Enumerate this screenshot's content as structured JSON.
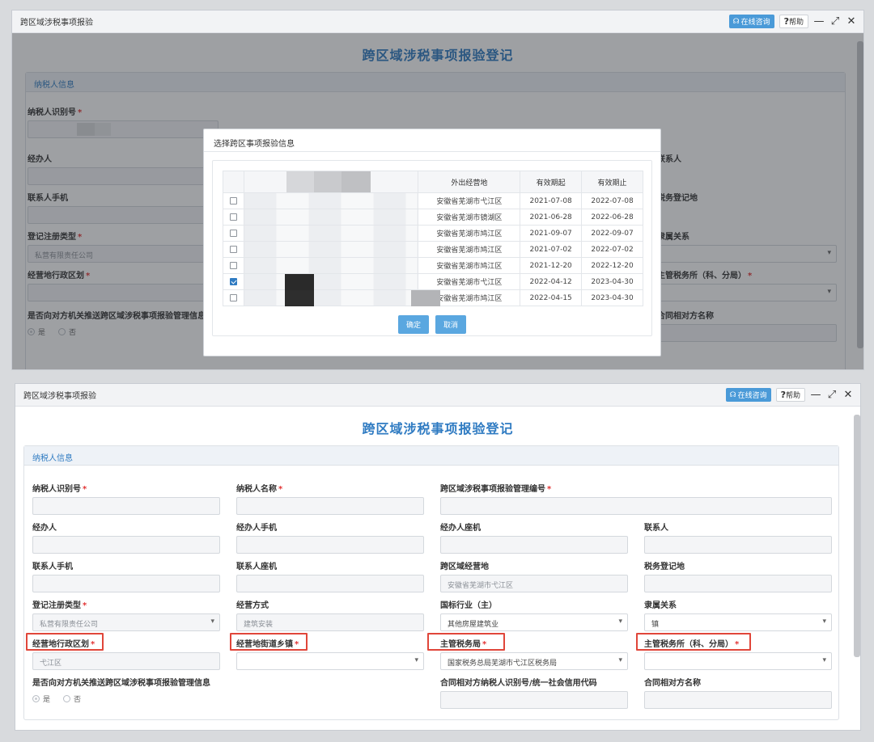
{
  "window": {
    "title": "跨区域涉税事项报验",
    "consult_label": "在线咨询",
    "help_label": "帮助",
    "help_mark": "?",
    "minimize": "—",
    "maximize": "⤢",
    "close": "✕"
  },
  "page_title": "跨区域涉税事项报验登记",
  "section_title": "纳税人信息",
  "fields": {
    "taxpayer_id": "纳税人识别号",
    "taxpayer_name": "纳税人名称",
    "mgmt_no": "跨区域涉税事项报验管理编号",
    "agent": "经办人",
    "agent_phone": "经办人手机",
    "agent_landline": "经办人座机",
    "contact": "联系人",
    "contact_phone": "联系人手机",
    "contact_landline": "联系人座机",
    "cross_region_place": "跨区域经营地",
    "cross_region_place_value": "安徽省芜湖市弋江区",
    "tax_reg_place": "税务登记地",
    "reg_type": "登记注册类型",
    "reg_type_value": "私营有限责任公司",
    "biz_mode": "经营方式",
    "biz_mode_value": "建筑安装",
    "industry": "国标行业（主）",
    "industry_value": "其他房屋建筑业",
    "affiliation": "隶属关系",
    "affiliation_value": "镇",
    "admin_district": "经营地行政区划",
    "admin_district_value": "弋江区",
    "street_town": "经营地街道乡镇",
    "tax_bureau": "主管税务局",
    "tax_bureau_value": "国家税务总局芜湖市弋江区税务局",
    "tax_office": "主管税务所（科、分局）",
    "push_info": "是否向对方机关推送跨区域涉税事项报验管理信息",
    "yes": "是",
    "no": "否",
    "counterparty_id": "合同相对方纳税人识别号/统一社会信用代码",
    "counterparty_name": "合同相对方名称"
  },
  "modal": {
    "title": "选择跨区事项报验信息",
    "headers": [
      "外出经营地",
      "有效期起",
      "有效期止"
    ],
    "rows": [
      {
        "place": "安徽省芜湖市弋江区",
        "start": "2021-07-08",
        "end": "2022-07-08",
        "checked": false
      },
      {
        "place": "安徽省芜湖市镜湖区",
        "start": "2021-06-28",
        "end": "2022-06-28",
        "checked": false
      },
      {
        "place": "安徽省芜湖市鸠江区",
        "start": "2021-09-07",
        "end": "2022-09-07",
        "checked": false
      },
      {
        "place": "安徽省芜湖市鸠江区",
        "start": "2021-07-02",
        "end": "2022-07-02",
        "checked": false
      },
      {
        "place": "安徽省芜湖市鸠江区",
        "start": "2021-12-20",
        "end": "2022-12-20",
        "checked": false
      },
      {
        "place": "安徽省芜湖市弋江区",
        "start": "2022-04-12",
        "end": "2023-04-30",
        "checked": true
      },
      {
        "place": "安徽省芜湖市鸠江区",
        "start": "2022-04-15",
        "end": "2023-04-30",
        "checked": false
      }
    ],
    "confirm": "确定",
    "cancel": "取消"
  },
  "colors": {
    "accent": "#2f7bc2",
    "required": "#e23434",
    "highlight": "#e0463a"
  }
}
